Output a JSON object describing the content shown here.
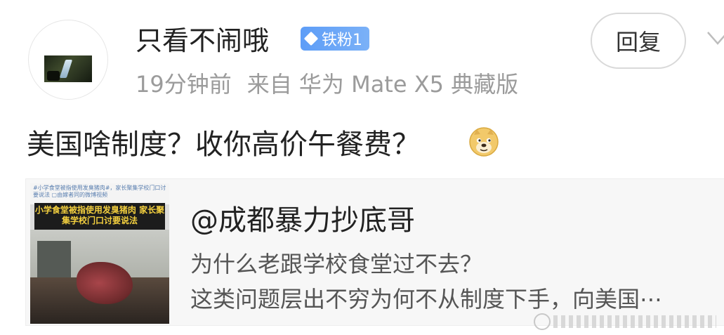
{
  "comment": {
    "username": "只看不闹哦",
    "badge": "铁粉1",
    "time": "19分钟前",
    "source": "来自 华为 Mate X5 典藏版",
    "reply_label": "回复",
    "text": "美国啥制度？收你高价午餐费？",
    "emoji_icon": "doge-emoji-icon"
  },
  "quoted": {
    "author": "@成都暴力抄底哥",
    "line1": "为什么老跟学校食堂过不去？",
    "line2": "这类问题层出不穷为何不从制度下手，向美国⋯",
    "thumb_topbar": "#小学食堂被指使用发臭猪肉#，家长聚集学校门口讨要说法 ▢由嫁者同的微博视频",
    "thumb_headline": "小学食堂被指使用发臭猪肉 家长聚集学校门口讨要说法"
  },
  "colors": {
    "badge": "#6aa8f7",
    "meta": "#9b9b9b",
    "card_bg": "#f7f7f7"
  }
}
